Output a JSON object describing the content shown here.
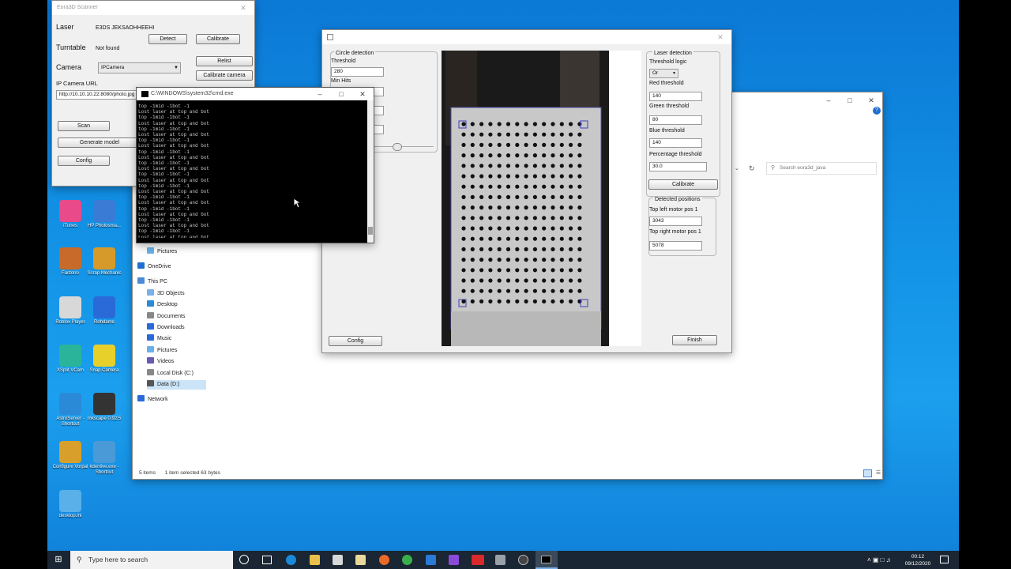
{
  "eora": {
    "title": "Eora3D Scanner",
    "laser_label": "Laser",
    "laser_value": "E3DS JEKSAOHHEEHI",
    "detect_btn": "Detect",
    "calibrate_btn": "Calibrate",
    "turntable_label": "Turntable",
    "turntable_value": "Not found",
    "camera_label": "Camera",
    "camera_value": "IPCamera",
    "relist_btn": "Relist",
    "calibrate_camera_btn": "Calibrate camera",
    "ip_camera_label": "IP Camera URL",
    "ip_camera_url": "http://10.10.10.22:8080/photo.jpg",
    "scan_btn": "Scan",
    "generate_model_btn": "Generate model",
    "config_btn": "Config"
  },
  "cmd": {
    "title": "C:\\WINDOWS\\system32\\cmd.exe",
    "lines": [
      "top -1mid -1bot -1",
      "Lost laser at top and bot",
      "top -1mid -1bot -1",
      "Lost laser at top and bot",
      "top -1mid -1bot -1",
      "Lost laser at top and bot",
      "top -1mid -1bot -1",
      "Lost laser at top and bot",
      "top -1mid -1bot -1",
      "Lost laser at top and bot",
      "top -1mid -1bot -1",
      "Lost laser at top and bot",
      "top -1mid -1bot -1",
      "Lost laser at top and bot",
      "top -1mid -1bot -1",
      "Lost laser at top and bot",
      "top -1mid -1bot -1",
      "Lost laser at top and bot",
      "top -1mid -1bot -1",
      "Lost laser at top and bot",
      "top -1mid -1bot -1",
      "Lost laser at top and bot",
      "top -1mid -1bot -1",
      "Lost laser at top and bot"
    ]
  },
  "calib": {
    "circle_detection": "Circle detection",
    "threshold_label": "Threshold",
    "threshold_value": "280",
    "min_hits_label": "Min Hits",
    "config_btn": "Config",
    "laser_detection": "Laser detection",
    "threshold_logic_label": "Threshold logic",
    "threshold_logic_value": "Or",
    "red_threshold_label": "Red threshold",
    "red_threshold_value": "140",
    "green_threshold_label": "Green threshold",
    "green_threshold_value": "80",
    "blue_threshold_label": "Blue threshold",
    "blue_threshold_value": "140",
    "percentage_threshold_label": "Percentage threshold",
    "percentage_threshold_value": "30.0",
    "calibrate_btn": "Calibrate",
    "detected_positions": "Detected positions",
    "top_left_label": "Top left motor pos 1",
    "top_left_value": "3043",
    "top_right_label": "Top right motor pos 1",
    "top_right_value": "5078",
    "finish_btn": "Finish"
  },
  "explorer": {
    "search_placeholder": "Search eora3d_java",
    "nav": [
      "Pictures",
      "OneDrive",
      "This PC",
      "3D Objects",
      "Desktop",
      "Documents",
      "Downloads",
      "Music",
      "Pictures",
      "Videos",
      "Local Disk (C:)",
      "Data (D:)",
      "Network"
    ],
    "status_items": "5 items",
    "status_selected": "1 item selected  63 bytes"
  },
  "desktop_icons": [
    {
      "label": "iTunes",
      "color": "#e84a8a"
    },
    {
      "label": "HP Photosma...",
      "color": "#3a7bd5"
    },
    {
      "label": "Factorio",
      "color": "#c76a2a"
    },
    {
      "label": "Scrap Mechanic",
      "color": "#d69a2a"
    },
    {
      "label": "Roblox Player",
      "color": "#d8d8d8"
    },
    {
      "label": "Rohdame",
      "color": "#2a6ad8"
    },
    {
      "label": "XSplit VCam",
      "color": "#2ab59a"
    },
    {
      "label": "Snap Camera",
      "color": "#e8d02a"
    },
    {
      "label": "AstroServer - Shortcut",
      "color": "#2a8ad8"
    },
    {
      "label": "Inkscape 0.92.5",
      "color": "#333333"
    },
    {
      "label": "Configure Vorpal",
      "color": "#d8a02a"
    },
    {
      "label": "kdenlive.exe - Shortcut",
      "color": "#4a9ad8"
    },
    {
      "label": "desktop.ini",
      "color": "#5ab0e8"
    }
  ],
  "taskbar": {
    "search_placeholder": "Type here to search",
    "time": "00:12",
    "date": "09/12/2020"
  }
}
